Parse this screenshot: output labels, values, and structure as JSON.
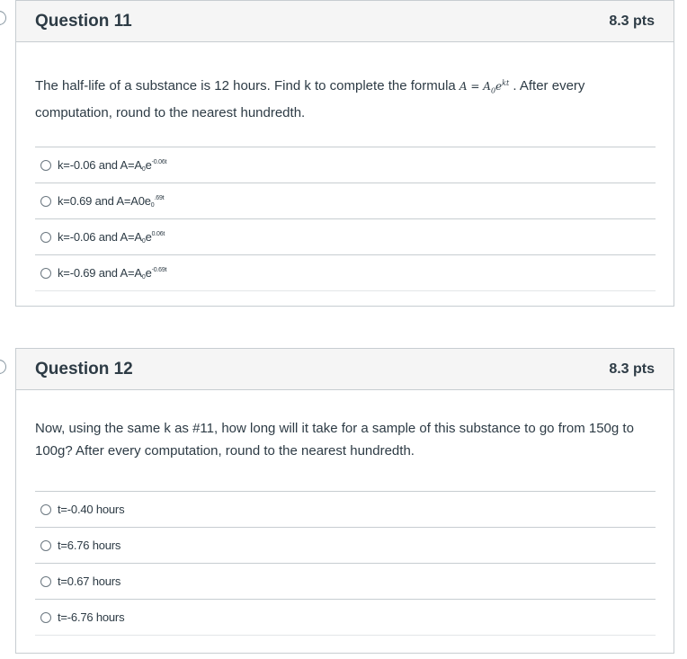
{
  "q11": {
    "title": "Question 11",
    "points": "8.3 pts",
    "text_before": "The half-life of a substance is 12 hours. Find k to complete the formula ",
    "formula_base": "A = A",
    "formula_sub": "0",
    "formula_e": "e",
    "formula_exp": "kt",
    "text_after": " . After every computation, round to the nearest hundredth.",
    "answers": [
      {
        "pre": "k=-0.06 and A=A",
        "sub": "0",
        "mid": "e",
        "sup": "-0.06t"
      },
      {
        "pre": "k=0.69 and A=A0e",
        "sub": "0",
        "mid": "",
        "sup": ".69t"
      },
      {
        "pre": "k=-0.06 and A=A",
        "sub": "0",
        "mid": "e",
        "sup": "0.06t"
      },
      {
        "pre": "k=-0.69 and A=A",
        "sub": "0",
        "mid": "e",
        "sup": "-0.69t"
      }
    ]
  },
  "q12": {
    "title": "Question 12",
    "points": "8.3 pts",
    "text": "Now, using the same k as #11, how long will it take for a sample of this substance to go from 150g to 100g? After every computation, round to the nearest hundredth.",
    "answers": [
      {
        "label": "t=-0.40 hours"
      },
      {
        "label": "t=6.76 hours"
      },
      {
        "label": "t=0.67 hours"
      },
      {
        "label": "t=-6.76 hours"
      }
    ]
  }
}
